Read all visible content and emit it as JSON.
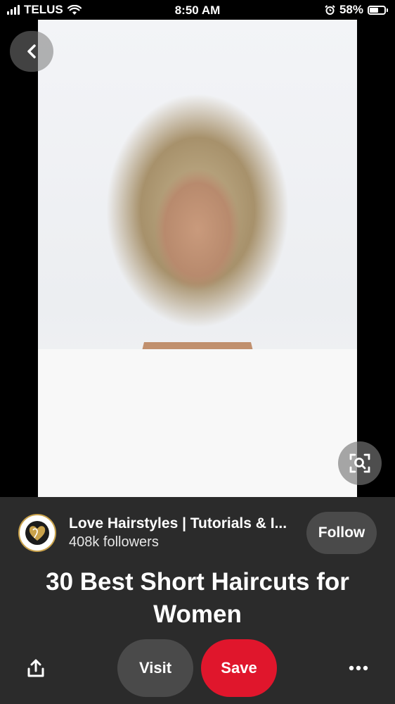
{
  "status_bar": {
    "carrier": "TELUS",
    "time": "8:50 AM",
    "battery_percent": "58%",
    "battery_level": 0.58
  },
  "pin": {
    "image_icon": "pin-photo",
    "back_icon": "chevron-left-icon",
    "lens_icon": "visual-search-icon"
  },
  "creator": {
    "name": "Love Hairstyles | Tutorials & I...",
    "followers": "408k followers",
    "follow_label": "Follow"
  },
  "title": "30 Best Short Haircuts for Women",
  "actions": {
    "share_icon": "share-icon",
    "visit_label": "Visit",
    "save_label": "Save",
    "more_icon": "more-horizontal-icon"
  },
  "colors": {
    "panel_bg": "#2b2b2b",
    "save_red": "#e0162c",
    "pill_gray": "#4a4a4a"
  }
}
